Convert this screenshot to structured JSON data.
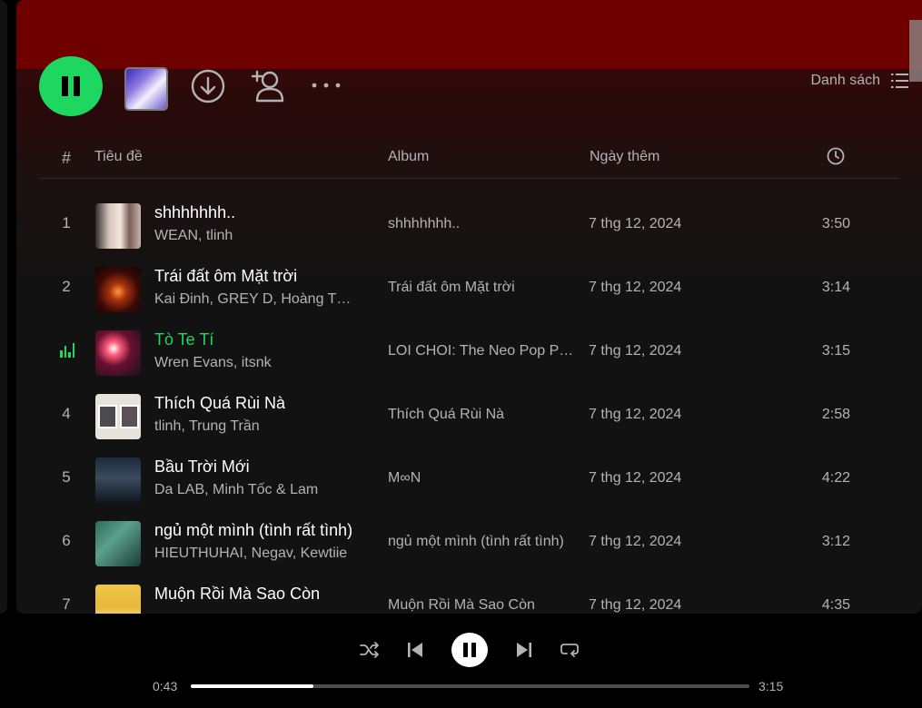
{
  "header": {
    "view_label": "Danh sách"
  },
  "icons": {
    "pause": "pause-icon",
    "download": "download-circle-icon",
    "add_user": "add-user-icon",
    "more": "more-icon",
    "list": "list-icon",
    "clock": "clock-icon",
    "shuffle": "shuffle-icon",
    "previous": "skip-back-icon",
    "next": "skip-forward-icon",
    "repeat": "repeat-icon",
    "playing": "equalizer-icon"
  },
  "colors": {
    "accent": "#1ed760",
    "header_band": "#6e0000",
    "background": "#121212"
  },
  "table": {
    "headers": {
      "number": "#",
      "title": "Tiêu đề",
      "album": "Album",
      "date_added": "Ngày thêm"
    },
    "rows": [
      {
        "number": "1",
        "title": "shhhhhhh..",
        "artists": "WEAN, tlinh",
        "album": "shhhhhhh..",
        "date": "7 thg 12, 2024",
        "duration": "3:50"
      },
      {
        "number": "2",
        "title": "Trái đất ôm Mặt trời",
        "artists": "Kai Đinh, GREY D, Hoàng Thùy Linh",
        "album": "Trái đất ôm Mặt trời",
        "date": "7 thg 12, 2024",
        "duration": "3:14"
      },
      {
        "number": "",
        "title": "Tò Te Tí",
        "artists": "Wren Evans, itsnk",
        "album": "LOI CHOI: The Neo Pop Punk",
        "date": "7 thg 12, 2024",
        "duration": "3:15",
        "playing": true
      },
      {
        "number": "4",
        "title": "Thích Quá Rùi Nà",
        "artists": "tlinh, Trung Trần",
        "album": "Thích Quá Rùi Nà",
        "date": "7 thg 12, 2024",
        "duration": "2:58"
      },
      {
        "number": "5",
        "title": "Bầu Trời Mới",
        "artists": "Da LAB, Minh Tốc & Lam",
        "album": "M∞N",
        "date": "7 thg 12, 2024",
        "duration": "4:22"
      },
      {
        "number": "6",
        "title": "ngủ một mình (tình rất tình)",
        "artists": "HIEUTHUHAI, Negav, Kewtiie",
        "album": "ngủ một mình (tình rất tình)",
        "date": "7 thg 12, 2024",
        "duration": "3:12"
      },
      {
        "number": "7",
        "title": "Muộn Rồi Mà Sao Còn",
        "artists": "",
        "album": "Muộn Rồi Mà Sao Còn",
        "date": "7 thg 12, 2024",
        "duration": "4:35"
      }
    ]
  },
  "player": {
    "elapsed": "0:43",
    "total": "3:15",
    "progress": 0.22
  }
}
